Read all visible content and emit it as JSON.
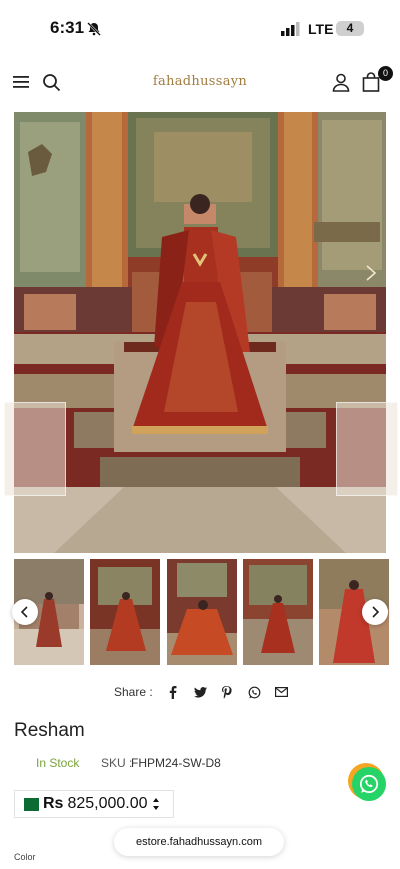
{
  "status_bar": {
    "time": "6:31",
    "network": "LTE",
    "battery": "4"
  },
  "header": {
    "logo": "fahadhussayn",
    "cart_count": "0"
  },
  "share": {
    "label": "Share :",
    "icons": [
      "facebook-icon",
      "twitter-icon",
      "pinterest-icon",
      "whatsapp-icon",
      "mail-icon"
    ]
  },
  "product": {
    "title": "Resham",
    "stock": "In Stock",
    "sku_label": "SKU :",
    "sku_value": "FHPM24-SW-D8",
    "currency": "Rs",
    "price": "825,000.00",
    "color_label": "Color"
  },
  "browser": {
    "url": "estore.fahadhussayn.com"
  },
  "colors": {
    "accent": "#a07c3e",
    "in_stock": "#7aa23a",
    "whatsapp": "#25d366"
  }
}
